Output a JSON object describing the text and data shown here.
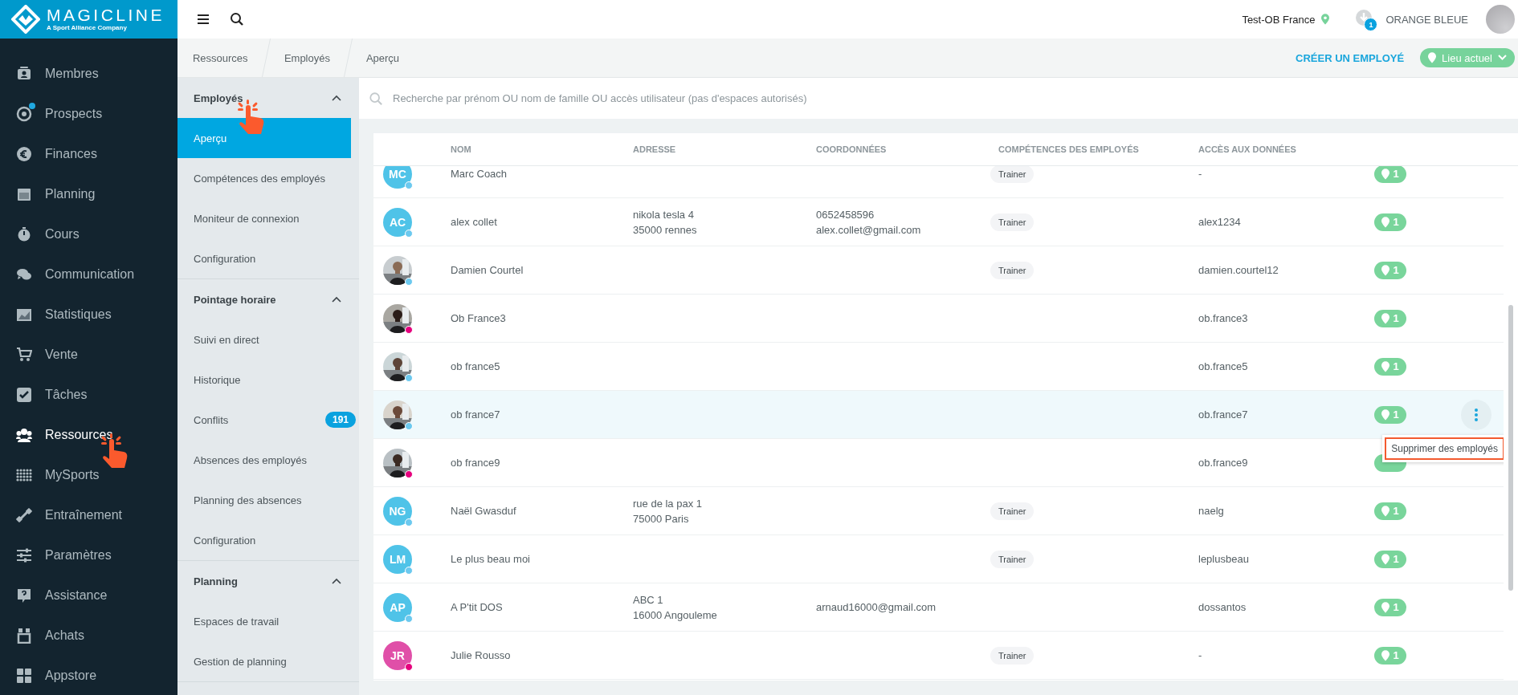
{
  "logo": {
    "name": "MAGICLINE",
    "tagline": "A Sport Alliance Company"
  },
  "nav": [
    {
      "label": "Membres",
      "selected": false,
      "dot": false
    },
    {
      "label": "Prospects",
      "selected": false,
      "dot": true
    },
    {
      "label": "Finances",
      "selected": false,
      "dot": false
    },
    {
      "label": "Planning",
      "selected": false,
      "dot": false
    },
    {
      "label": "Cours",
      "selected": false,
      "dot": false
    },
    {
      "label": "Communication",
      "selected": false,
      "dot": false
    },
    {
      "label": "Statistiques",
      "selected": false,
      "dot": false
    },
    {
      "label": "Vente",
      "selected": false,
      "dot": false
    },
    {
      "label": "Tâches",
      "selected": false,
      "dot": false
    },
    {
      "label": "Ressources",
      "selected": true,
      "dot": false
    },
    {
      "label": "MySports",
      "selected": false,
      "dot": false
    },
    {
      "label": "Entraînement",
      "selected": false,
      "dot": false
    },
    {
      "label": "Paramètres",
      "selected": false,
      "dot": false
    },
    {
      "label": "Assistance",
      "selected": false,
      "dot": false
    },
    {
      "label": "Achats",
      "selected": false,
      "dot": false
    },
    {
      "label": "Appstore",
      "selected": false,
      "dot": false
    }
  ],
  "topbar": {
    "studio": "Test-OB France",
    "notifications": "1",
    "user": "ORANGE BLEUE"
  },
  "breadcrumb": [
    "Ressources",
    "Employés",
    "Aperçu"
  ],
  "actions": {
    "create": "CRÉER UN EMPLOYÉ",
    "location": "Lieu actuel"
  },
  "subnav": [
    {
      "title": "Employés",
      "expanded": true,
      "items": [
        {
          "label": "Aperçu",
          "selected": true
        },
        {
          "label": "Compétences des employés",
          "selected": false
        },
        {
          "label": "Moniteur de connexion",
          "selected": false
        },
        {
          "label": "Configuration",
          "selected": false
        }
      ]
    },
    {
      "title": "Pointage horaire",
      "expanded": true,
      "items": [
        {
          "label": "Suivi en direct",
          "selected": false
        },
        {
          "label": "Historique",
          "selected": false
        },
        {
          "label": "Conflits",
          "selected": false,
          "count": "191"
        },
        {
          "label": "Absences des employés",
          "selected": false
        },
        {
          "label": "Planning des absences",
          "selected": false
        },
        {
          "label": "Configuration",
          "selected": false
        }
      ]
    },
    {
      "title": "Planning",
      "expanded": true,
      "items": [
        {
          "label": "Espaces de travail",
          "selected": false
        },
        {
          "label": "Gestion de planning",
          "selected": false
        }
      ]
    }
  ],
  "search": {
    "placeholder": "Recherche par prénom OU nom de famille OU accès utilisateur (pas d'espaces autorisés)"
  },
  "table": {
    "columns": [
      "NOM",
      "ADRESSE",
      "COORDONNÉES",
      "COMPÉTENCES DES EMPLOYÉS",
      "ACCÈS AUX DONNÉES"
    ],
    "rows": [
      {
        "avatar": {
          "kind": "initials",
          "initials": "MC",
          "color": "#4fc3e8"
        },
        "color": "#6cc9ef",
        "name": "Marc Coach",
        "address": [],
        "contact": [],
        "skill": "Trainer",
        "access": "-",
        "locations": "1",
        "selected": false
      },
      {
        "avatar": {
          "kind": "initials",
          "initials": "AC",
          "color": "#4fc3e8"
        },
        "color": "#6cc9ef",
        "name": "alex collet",
        "address": [
          "nikola tesla 4",
          "35000 rennes"
        ],
        "contact": [
          "0652458596",
          "alex.collet@gmail.com"
        ],
        "skill": "Trainer",
        "access": "alex1234",
        "locations": "1",
        "selected": false
      },
      {
        "avatar": {
          "kind": "picture"
        },
        "color": "#6cc9ef",
        "name": "Damien Courtel",
        "address": [],
        "contact": [],
        "skill": "Trainer",
        "access": "damien.courtel12",
        "locations": "1",
        "selected": false
      },
      {
        "avatar": {
          "kind": "picture"
        },
        "color": "#e6007e",
        "name": "Ob France3",
        "address": [],
        "contact": [],
        "access": "ob.france3",
        "locations": "1",
        "selected": false
      },
      {
        "avatar": {
          "kind": "picture"
        },
        "color": "#6cc9ef",
        "name": "ob france5",
        "address": [],
        "contact": [],
        "access": "ob.france5",
        "locations": "1",
        "selected": false
      },
      {
        "avatar": {
          "kind": "picture"
        },
        "color": "#6cc9ef",
        "name": "ob france7",
        "address": [],
        "contact": [],
        "access": "ob.france7",
        "locations": "1",
        "selected": true,
        "menu": {
          "item": "Supprimer des employés"
        }
      },
      {
        "avatar": {
          "kind": "picture"
        },
        "color": "#e6007e",
        "name": "ob france9",
        "address": [],
        "contact": [],
        "access": "ob.france9",
        "selected": false
      },
      {
        "avatar": {
          "kind": "initials",
          "initials": "NG",
          "color": "#4fc3e8"
        },
        "color": "#6cc9ef",
        "name": "Naël Gwasduf",
        "address": [
          "rue de la pax 1",
          "75000 Paris"
        ],
        "contact": [],
        "skill": "Trainer",
        "access": "naelg",
        "locations": "1",
        "selected": false
      },
      {
        "avatar": {
          "kind": "initials",
          "initials": "LM",
          "color": "#4fc3e8"
        },
        "color": "#6cc9ef",
        "name": "Le plus beau moi",
        "address": [],
        "contact": [],
        "skill": "Trainer",
        "access": "leplusbeau",
        "locations": "1",
        "selected": false
      },
      {
        "avatar": {
          "kind": "initials",
          "initials": "AP",
          "color": "#4fc3e8"
        },
        "color": "#6cc9ef",
        "name": "A P'tit DOS",
        "address": [
          "ABC 1",
          "16000 Angouleme"
        ],
        "contact": [
          "arnaud16000@gmail.com"
        ],
        "access": "dossantos",
        "locations": "1",
        "selected": false
      },
      {
        "avatar": {
          "kind": "initials",
          "initials": "JR",
          "color": "#e04fa8"
        },
        "color": "#e6007e",
        "name": "Julie Rousso",
        "address": [],
        "contact": [],
        "skill": "Trainer",
        "access": "-",
        "locations": "1",
        "selected": false
      }
    ]
  }
}
